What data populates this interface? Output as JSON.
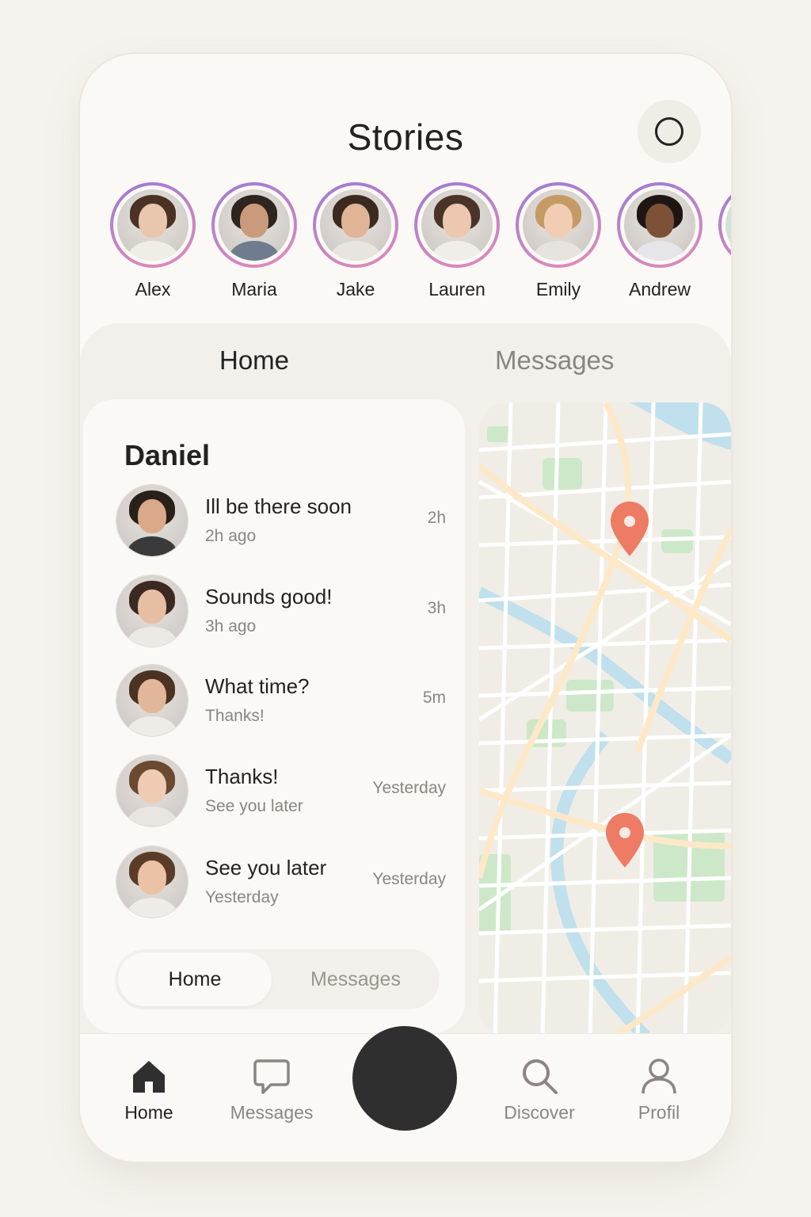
{
  "header": {
    "title": "Stories",
    "action_icon": "circle-icon"
  },
  "stories": [
    {
      "name": "Alex",
      "hair": "#4a3224",
      "skin": "#e9c6ae",
      "shirt": "#f0ece6"
    },
    {
      "name": "Maria",
      "hair": "#2e2520",
      "skin": "#c99a7c",
      "shirt": "#6f7c8e"
    },
    {
      "name": "Jake",
      "hair": "#3b2a20",
      "skin": "#e0b497",
      "shirt": "#e8e4df"
    },
    {
      "name": "Lauren",
      "hair": "#4a3428",
      "skin": "#ecc8b0",
      "shirt": "#f1ede8"
    },
    {
      "name": "Emily",
      "hair": "#c59a64",
      "skin": "#f1cdb4",
      "shirt": "#e7e3de"
    },
    {
      "name": "Andrew",
      "hair": "#1e1612",
      "skin": "#7c5138",
      "shirt": "#e6e6ea"
    }
  ],
  "tabs": {
    "home": "Home",
    "messages": "Messages"
  },
  "chat": {
    "title": "Daniel",
    "items": [
      {
        "message": "Ill be there soon",
        "sub": "2h ago",
        "time": "2h",
        "hair": "#2a201a",
        "skin": "#d9a98a",
        "shirt": "#3a3a3a"
      },
      {
        "message": "Sounds good!",
        "sub": "3h ago",
        "time": "3h",
        "hair": "#3c2a22",
        "skin": "#e6bea3",
        "shirt": "#ede9e4"
      },
      {
        "message": "What time?",
        "sub": "Thanks!",
        "time": "5m",
        "hair": "#4b3222",
        "skin": "#e2b69a",
        "shirt": "#efebe6"
      },
      {
        "message": "Thanks!",
        "sub": "See you later",
        "time": "Yesterday",
        "hair": "#6b4a32",
        "skin": "#efcbb4",
        "shirt": "#e9e5e0"
      },
      {
        "message": "See you later",
        "sub": "Yesterday",
        "time": "Yesterday",
        "hair": "#5b3c28",
        "skin": "#ebc2a6",
        "shirt": "#efebe6"
      }
    ],
    "segment": {
      "home": "Home",
      "messages": "Messages"
    }
  },
  "map": {
    "pins": 2,
    "pin_color": "#ee7b64",
    "water_color": "#bfe0ec",
    "park_color": "#cde8c8",
    "road_color": "#fde9c8"
  },
  "nav": {
    "home": "Home",
    "messages": "Messages",
    "discover": "Discover",
    "profile": "Profil",
    "active_color": "#222222",
    "inactive_color": "#8a8580"
  }
}
